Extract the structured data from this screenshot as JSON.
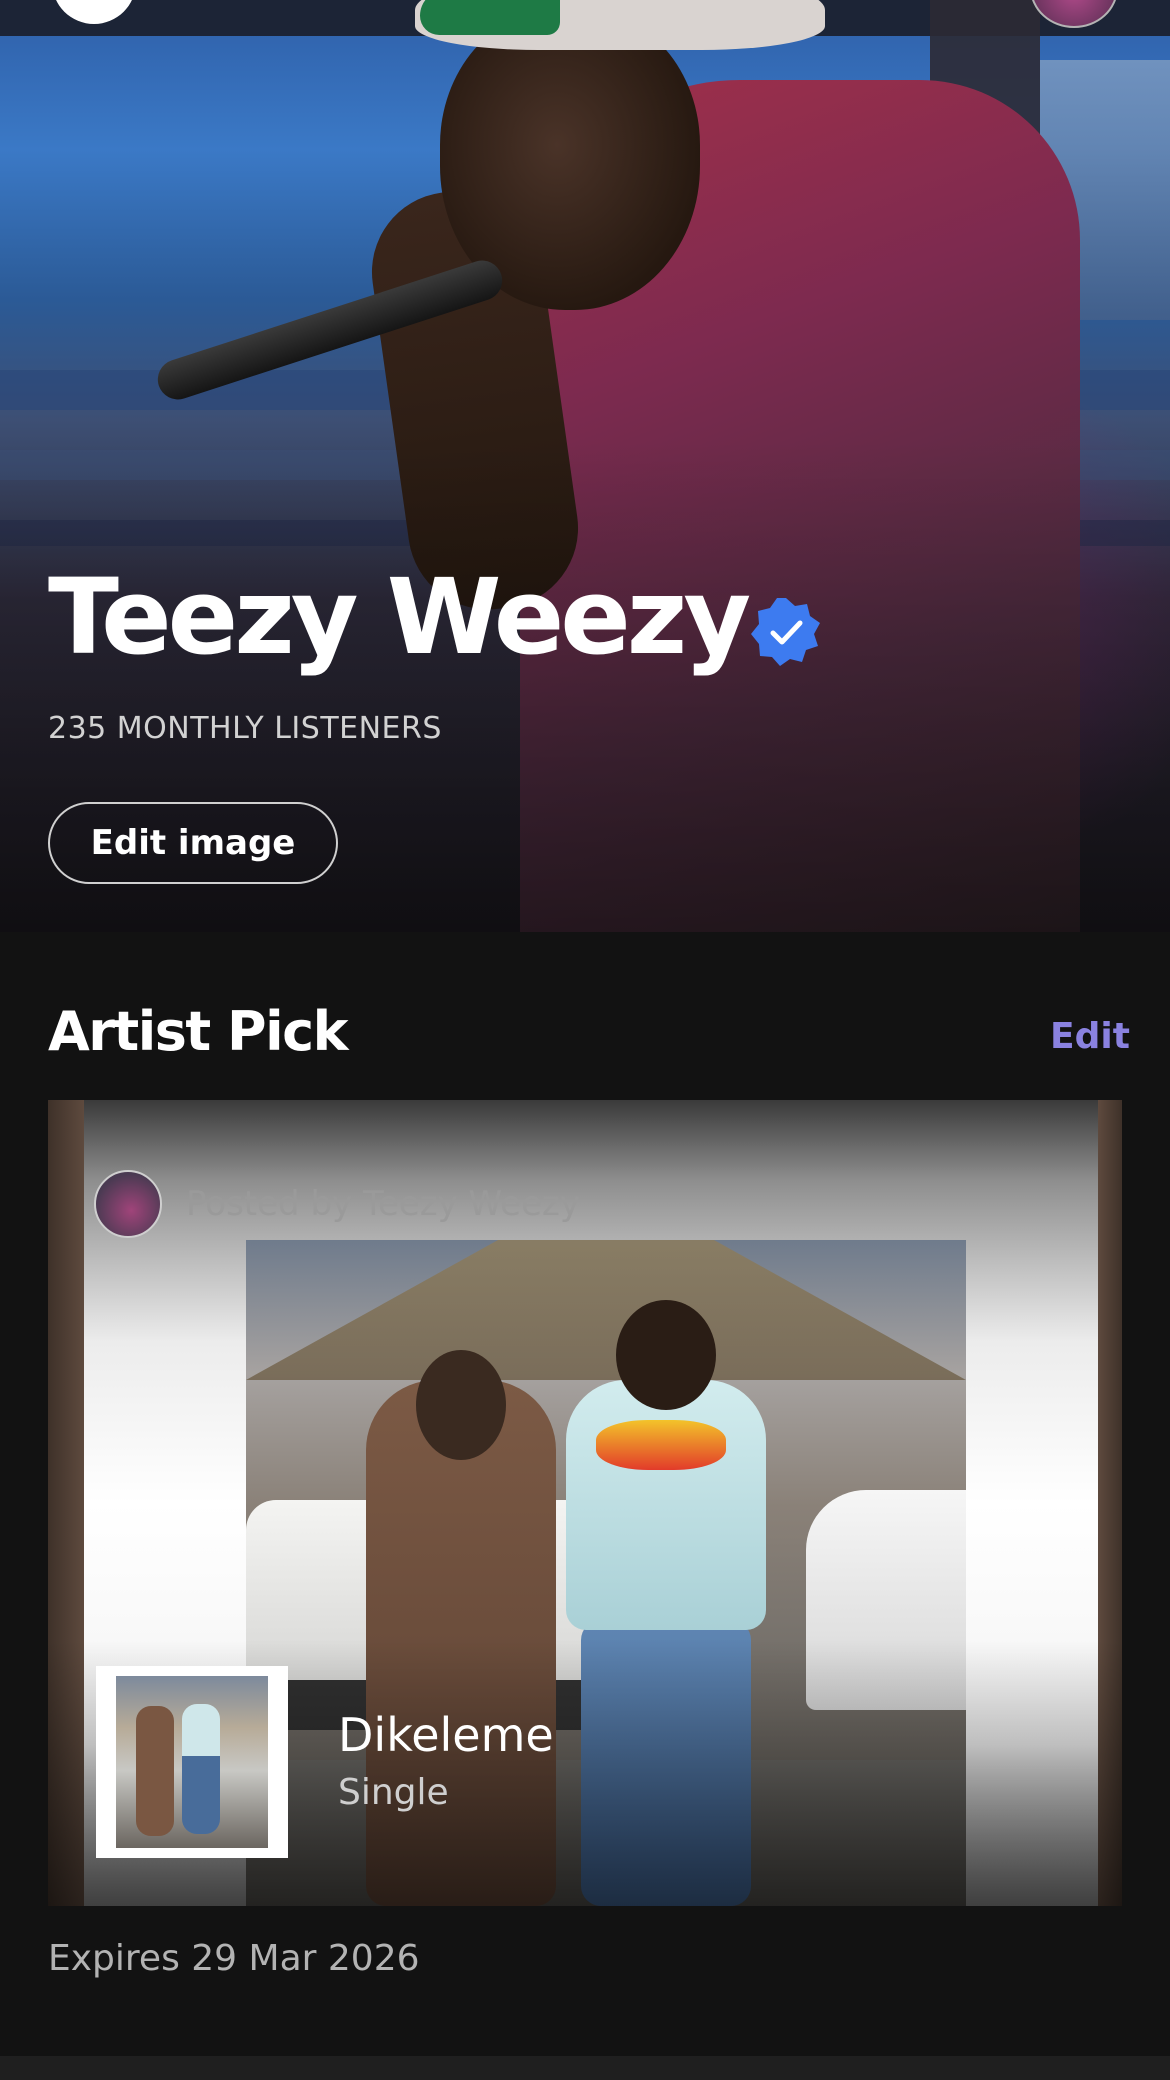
{
  "artist": {
    "name": "Teezy Weezy",
    "monthly_listeners": "235 MONTHLY LISTENERS",
    "verified": true,
    "edit_image_label": "Edit image"
  },
  "artist_pick": {
    "title": "Artist Pick",
    "edit_label": "Edit",
    "posted_by": "Posted by Teezy Weezy",
    "release": {
      "title": "Dikeleme",
      "type": "Single"
    },
    "expires": "Expires 29 Mar 2026"
  },
  "colors": {
    "background": "#121212",
    "accent_link": "#8a82e0",
    "verified_badge": "#3d7bf0"
  },
  "icons": {
    "verified": "verified-badge-icon"
  }
}
